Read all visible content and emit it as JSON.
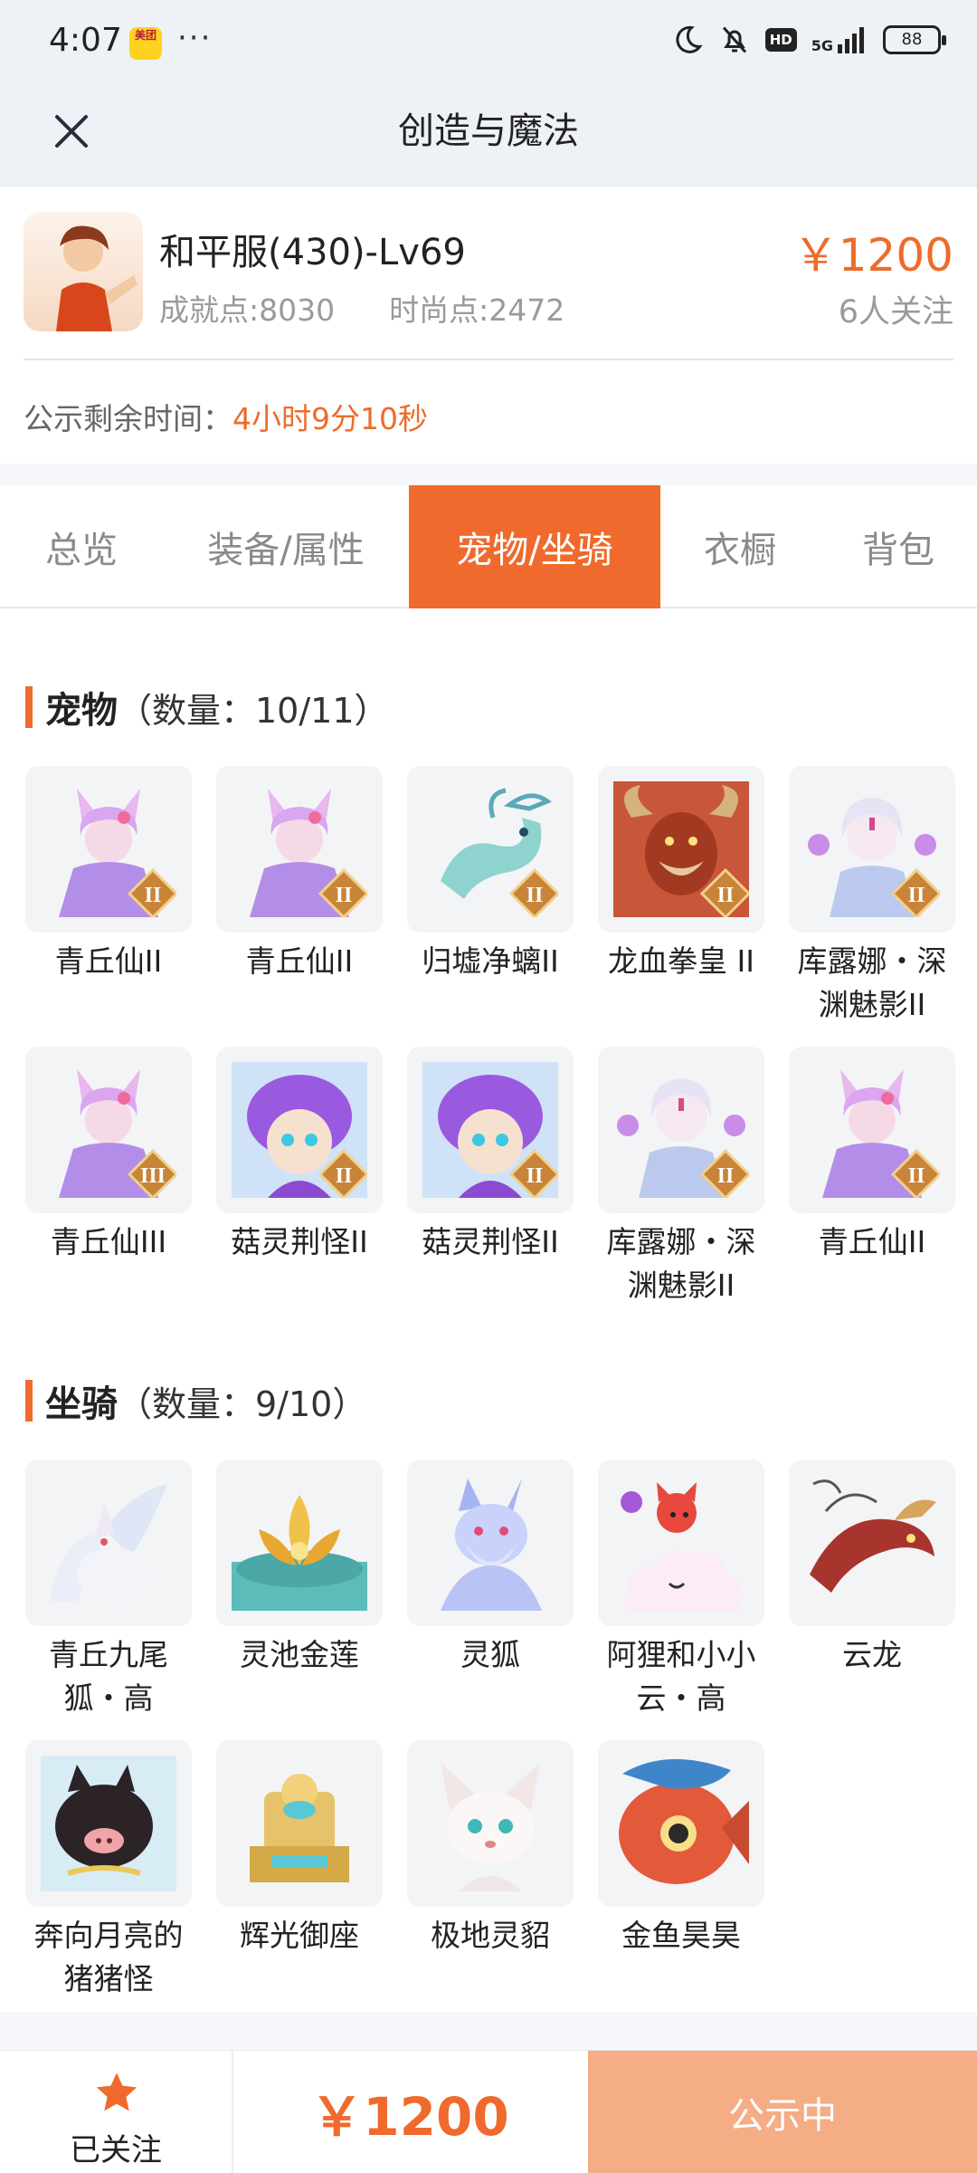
{
  "status_bar": {
    "time": "4:07",
    "app_badge": "美团",
    "dots": "···",
    "network": "5G",
    "battery": "88",
    "hd": "HD"
  },
  "nav": {
    "title": "创造与魔法"
  },
  "summary": {
    "name": "和平服(430)-Lv69",
    "achievement": "成就点:8030",
    "fashion": "时尚点:2472",
    "price": "￥1200",
    "followers": "6人关注",
    "timer_label": "公示剩余时间：",
    "timer_value": "4小时9分10秒"
  },
  "tabs": [
    "总览",
    "装备/属性",
    "宠物/坐骑",
    "衣橱",
    "背包"
  ],
  "active_tab": 2,
  "pets": {
    "title": "宠物",
    "count": "（数量：10/11）",
    "items": [
      {
        "label": "青丘仙II",
        "icon": "fox-fairy-pet-icon"
      },
      {
        "label": "青丘仙II",
        "icon": "fox-fairy-pet-icon"
      },
      {
        "label": "归墟净螭II",
        "icon": "dragon-pet-icon"
      },
      {
        "label": "龙血拳皇 II",
        "icon": "minotaur-pet-icon"
      },
      {
        "label": "库露娜・深渊魅影II",
        "icon": "kuluna-pet-icon"
      },
      {
        "label": "青丘仙III",
        "icon": "fox-fairy-pet-icon"
      },
      {
        "label": "菇灵荆怪II",
        "icon": "mushroom-pet-icon"
      },
      {
        "label": "菇灵荆怪II",
        "icon": "mushroom-pet-icon"
      },
      {
        "label": "库露娜・深渊魅影II",
        "icon": "kuluna-pet-icon"
      },
      {
        "label": "青丘仙II",
        "icon": "fox-fairy-pet-icon"
      }
    ]
  },
  "mounts": {
    "title": "坐骑",
    "count": "（数量：9/10）",
    "items": [
      {
        "label": "青丘九尾狐・高",
        "icon": "nine-tail-fox-mount-icon"
      },
      {
        "label": "灵池金莲",
        "icon": "golden-lotus-mount-icon"
      },
      {
        "label": "灵狐",
        "icon": "spirit-fox-mount-icon"
      },
      {
        "label": "阿狸和小小云・高",
        "icon": "ahri-cloud-mount-icon"
      },
      {
        "label": "云龙",
        "icon": "cloud-dragon-mount-icon"
      },
      {
        "label": "奔向月亮的猪猪怪",
        "icon": "pig-mount-icon"
      },
      {
        "label": "辉光御座",
        "icon": "throne-mount-icon"
      },
      {
        "label": "极地灵貂",
        "icon": "arctic-mink-mount-icon"
      },
      {
        "label": "金鱼昊昊",
        "icon": "goldfish-mount-icon"
      }
    ]
  },
  "bottom": {
    "follow_label": "已关注",
    "price": "￥1200",
    "status_button": "公示中"
  },
  "colors": {
    "accent": "#ef6a2c",
    "light_accent": "#f4ad84"
  }
}
